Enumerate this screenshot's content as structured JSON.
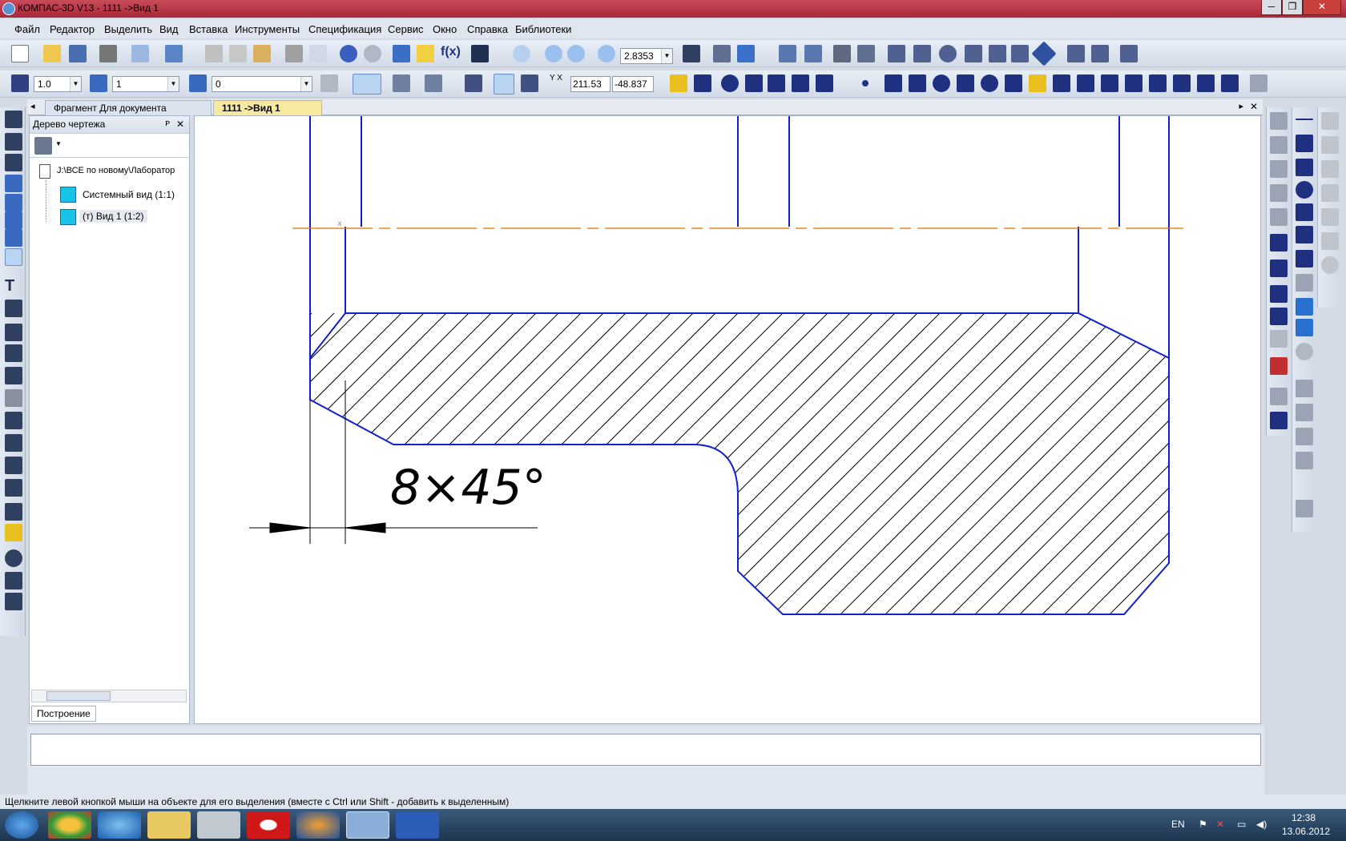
{
  "window": {
    "title": "КОМПАС-3D V13 - 1111 ->Вид 1",
    "minimize": "─",
    "maximize": "❐",
    "close": "✕"
  },
  "menu": [
    "Файл",
    "Редактор",
    "Выделить",
    "Вид",
    "Вставка",
    "Инструменты",
    "Спецификация",
    "Сервис",
    "Окно",
    "Справка",
    "Библиотеки"
  ],
  "toolbar": {
    "zoom_value": "2.8353",
    "line_width": "1.0",
    "view_number": "1",
    "layer_number": "0",
    "coord_x": "211.53",
    "coord_y": "-48.837",
    "coord_label": "Y X"
  },
  "tabs": [
    {
      "label": "Фрагмент Для документа"
    },
    {
      "label": "1111 ->Вид 1"
    }
  ],
  "tree": {
    "title": "Дерево чертежа",
    "root": "J:\\ВСЕ по новому\\Лаборатор",
    "items": [
      "Системный вид (1:1)",
      "(т) Вид 1 (1:2)"
    ],
    "bottom_tab": "Построение",
    "pin": "ᴘ",
    "close": "✕"
  },
  "drawing": {
    "dimension_text": "8×45°",
    "axis_label": "x"
  },
  "status": {
    "hint": "Щелкните левой кнопкой мыши на объекте для его выделения (вместе с Ctrl или Shift - добавить к выделенным)"
  },
  "taskbar": {
    "lang": "EN",
    "time": "12:38",
    "date": "13.06.2012"
  },
  "colors": {
    "outline": "#1020d0",
    "hatch": "#000000",
    "axis": "#e07000",
    "titlebar": "#b8303f"
  }
}
